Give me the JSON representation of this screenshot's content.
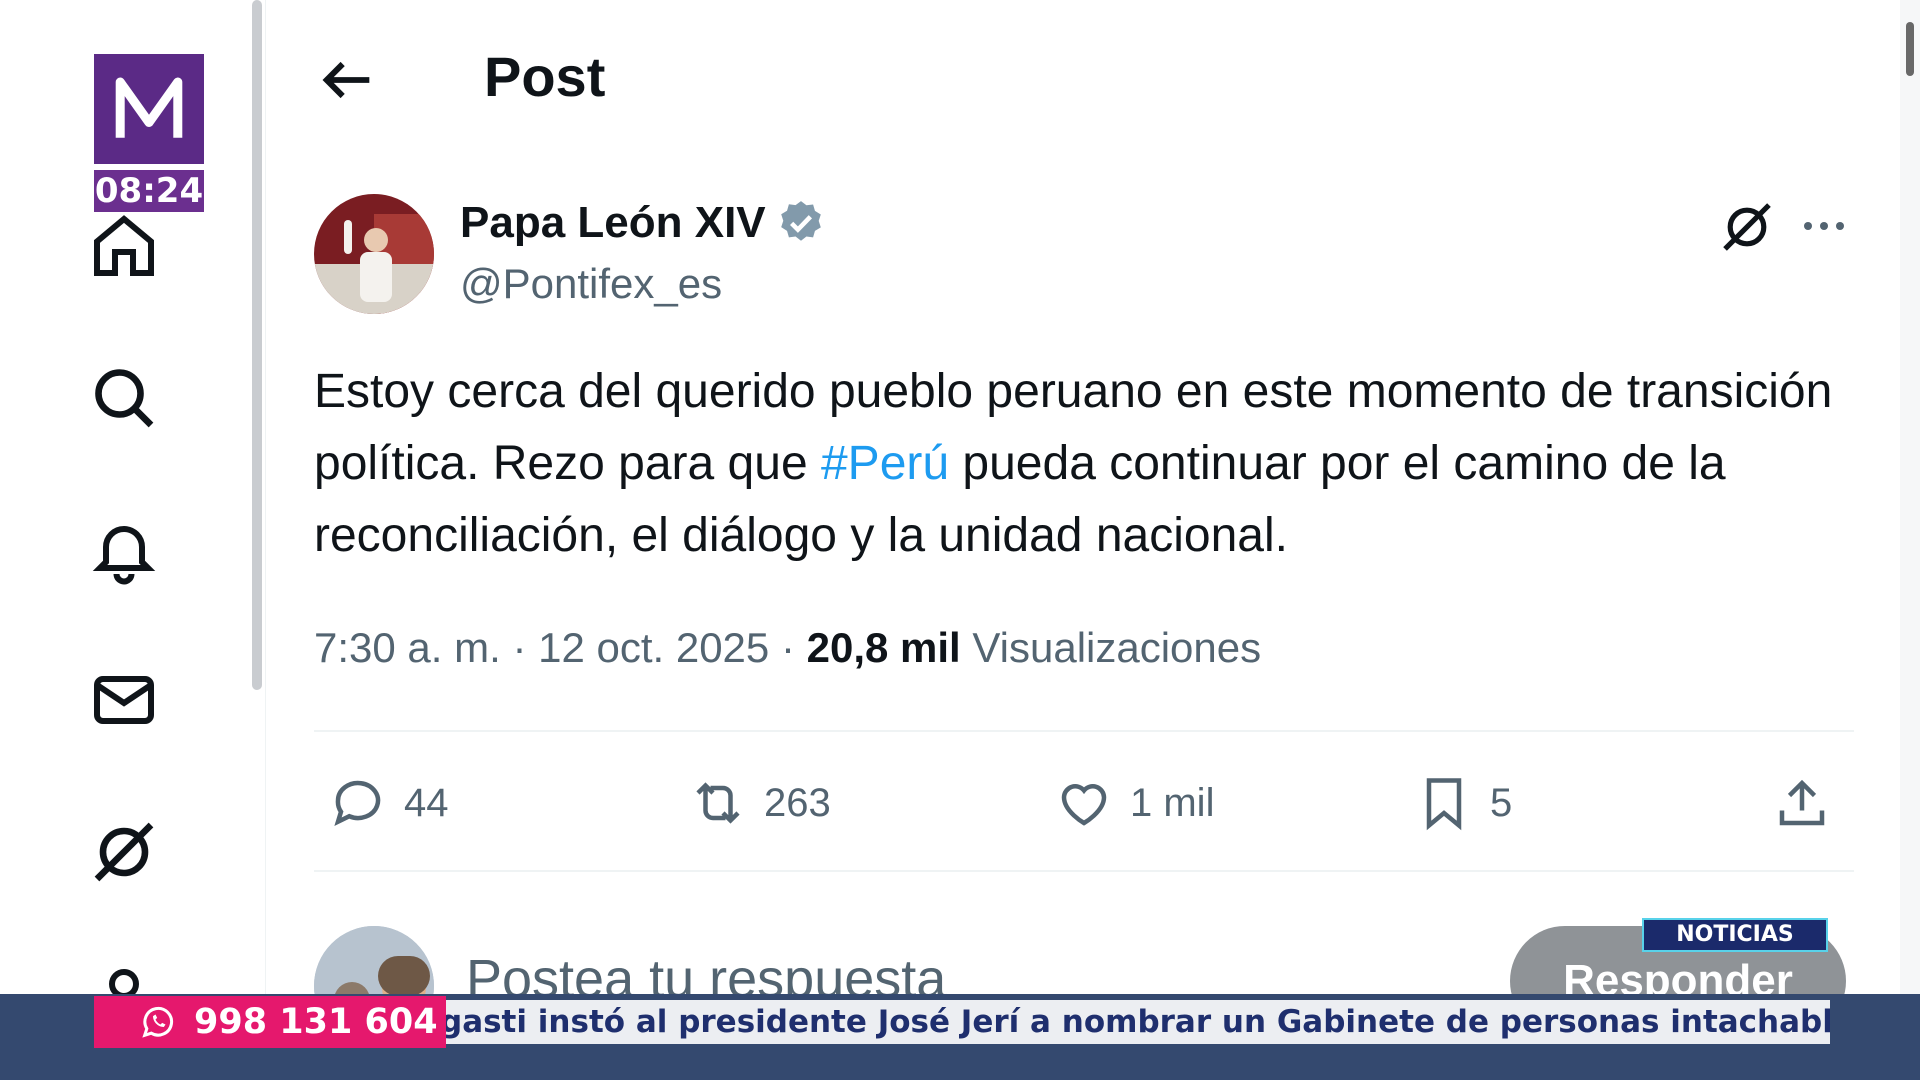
{
  "channel": {
    "time": "08:24",
    "brand": "NOTICIAS",
    "phone": "998 131 604",
    "ticker": "gasti instó al presidente José Jerí a nombrar un Gabinete de personas intachables, con"
  },
  "header": {
    "title": "Post"
  },
  "post": {
    "author_name": "Papa León XIV",
    "handle": "@Pontifex_es",
    "text_before": "Estoy cerca del querido pueblo peruano en este momento de transición política. Rezo para que ",
    "hashtag": "#Perú",
    "text_after": " pueda continuar por el camino de la reconciliación, el diálogo y la unidad nacional.",
    "time": "7:30 a. m.",
    "date": "12 oct. 2025",
    "views_count": "20,8 mil",
    "views_label": "Visualizaciones",
    "replies": "44",
    "reposts": "263",
    "likes": "1 mil",
    "bookmarks": "5"
  },
  "reply": {
    "placeholder": "Postea tu respuesta",
    "button": "Responder"
  },
  "icons": [
    "home-icon",
    "search-icon",
    "bell-icon",
    "mail-icon",
    "grok-icon",
    "profile-icon",
    "back-arrow-icon",
    "verified-icon",
    "more-icon",
    "reply-icon",
    "repost-icon",
    "like-icon",
    "bookmark-icon",
    "share-icon",
    "whatsapp-icon"
  ],
  "colors": {
    "accent": "#1d9bf0",
    "ticker_bg": "#34496f",
    "phone_bg": "#e5186d",
    "logo_bg": "#5b2a86"
  }
}
